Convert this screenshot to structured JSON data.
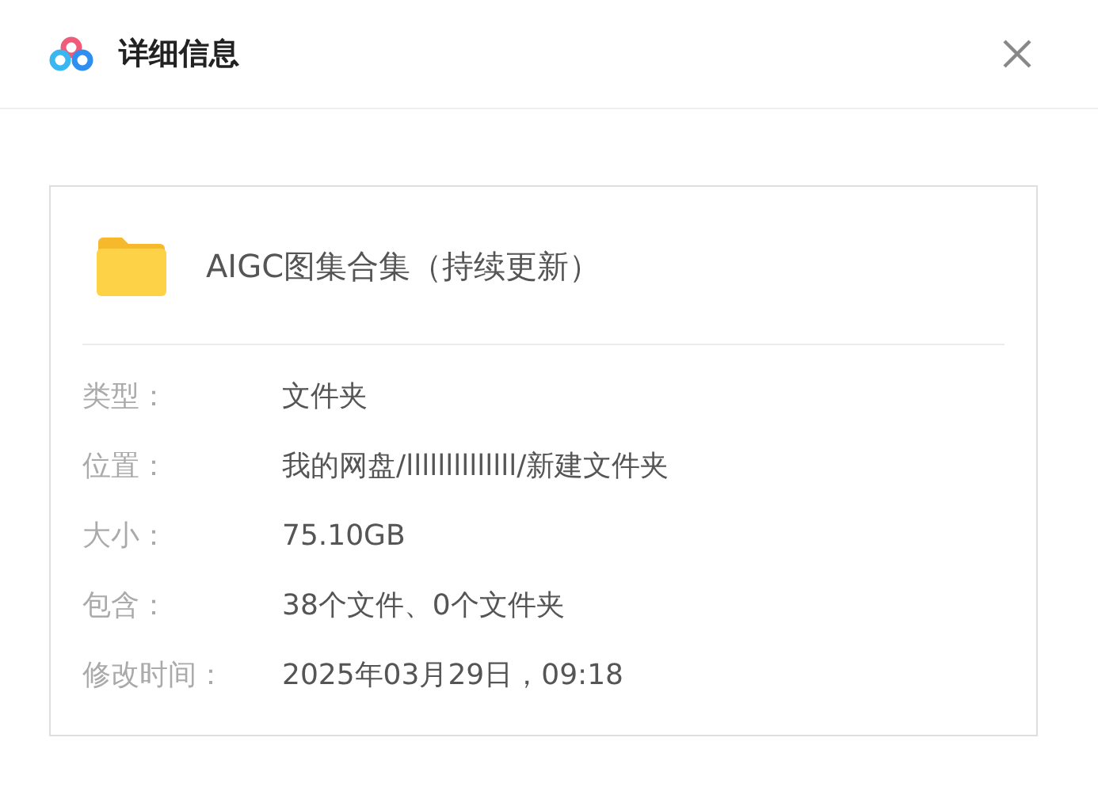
{
  "dialog": {
    "title": "详细信息"
  },
  "file": {
    "name": "AIGC图集合集（持续更新）"
  },
  "details": [
    {
      "label": "类型：",
      "value": "文件夹"
    },
    {
      "label": "位置：",
      "value": "我的网盘/llllllllllllll/新建文件夹"
    },
    {
      "label": "大小：",
      "value": "75.10GB"
    },
    {
      "label": "包含：",
      "value": "38个文件、0个文件夹"
    },
    {
      "label": "修改时间：",
      "value": "2025年03月29日，09:18"
    }
  ]
}
